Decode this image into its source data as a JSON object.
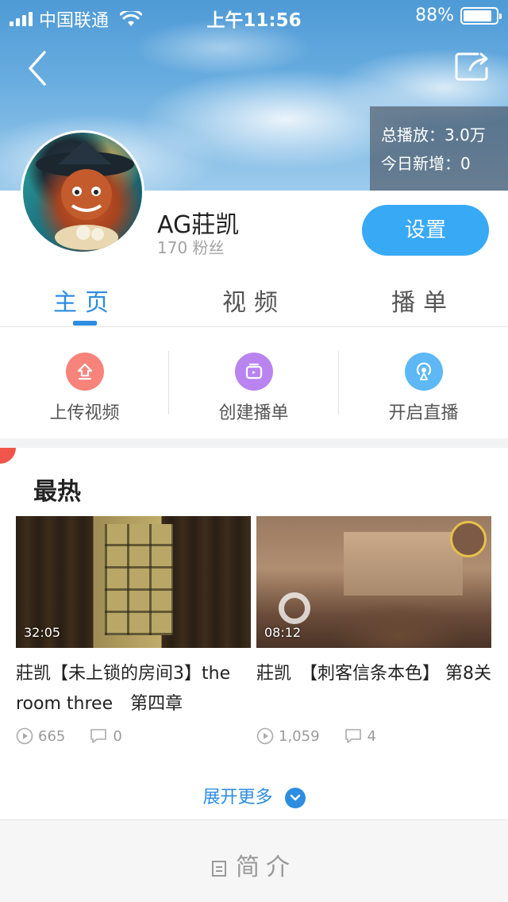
{
  "status_bar": {
    "carrier": "中国联通",
    "time": "上午11:56",
    "battery": "88%",
    "battery_level": 0.88
  },
  "header": {
    "back_icon": "chevron-left-icon",
    "share_icon": "share-icon",
    "stats": {
      "total_plays": "总播放：3.0万",
      "today_new": "今日新增：0"
    }
  },
  "profile": {
    "username": "AG莊凯",
    "fans": "170 粉丝",
    "settings_label": "设置"
  },
  "tabs": [
    {
      "label": "主页",
      "active": true
    },
    {
      "label": "视频",
      "active": false
    },
    {
      "label": "播单",
      "active": false
    }
  ],
  "actions": [
    {
      "label": "上传视频",
      "icon": "upload-icon",
      "color": "#f7837a"
    },
    {
      "label": "创建播单",
      "icon": "playlist-icon",
      "color": "#b984f0"
    },
    {
      "label": "开启直播",
      "icon": "live-icon",
      "color": "#5db8f5"
    }
  ],
  "hot": {
    "title": "最热",
    "videos": [
      {
        "duration": "32:05",
        "title": "莊凯【未上锁的房间3】the room three　第四章",
        "plays": "665",
        "comments": "0"
      },
      {
        "duration": "08:12",
        "title": "莊凯　【刺客信条本色】 第8关",
        "plays": "1,059",
        "comments": "4"
      }
    ],
    "more_label": "展开更多"
  },
  "intro": {
    "label": "简介"
  },
  "colors": {
    "accent": "#2d8de0",
    "button": "#38a9f5"
  }
}
